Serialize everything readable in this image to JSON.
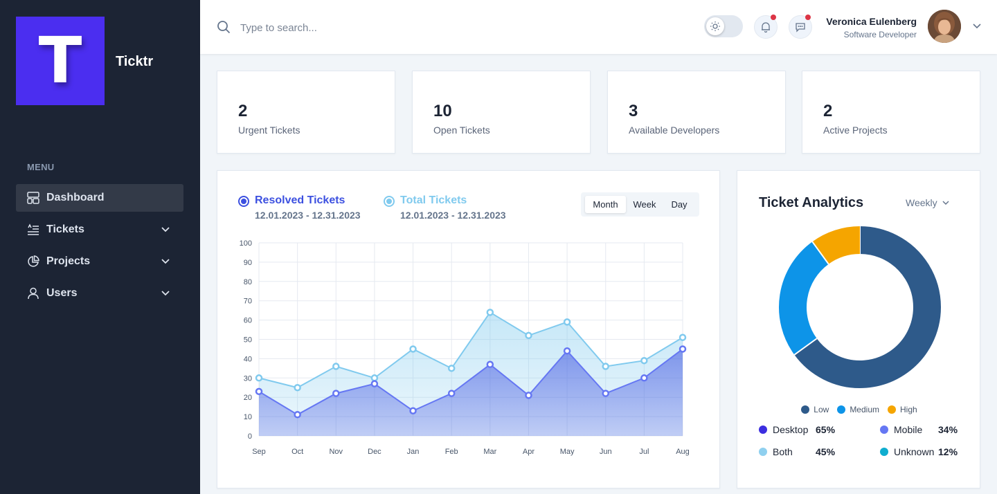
{
  "app": {
    "logo_letter": "T",
    "brand": "Ticktr"
  },
  "sidebar": {
    "menu_title": "MENU",
    "items": [
      {
        "label": "Dashboard",
        "icon": "dashboard-icon",
        "active": true
      },
      {
        "label": "Tickets",
        "icon": "tickets-icon",
        "expandable": true
      },
      {
        "label": "Projects",
        "icon": "projects-icon",
        "expandable": true
      },
      {
        "label": "Users",
        "icon": "users-icon",
        "expandable": true
      }
    ]
  },
  "header": {
    "search_placeholder": "Type to search...",
    "notifications_unread": true,
    "messages_unread": true,
    "user": {
      "name": "Veronica Eulenberg",
      "role": "Software Developer"
    }
  },
  "stats": [
    {
      "value": "2",
      "label": "Urgent Tickets"
    },
    {
      "value": "10",
      "label": "Open Tickets"
    },
    {
      "value": "3",
      "label": "Available Developers"
    },
    {
      "value": "2",
      "label": "Active Projects"
    }
  ],
  "chart_panel": {
    "legend": [
      {
        "title": "Resolved Tickets",
        "dates": "12.01.2023 - 12.31.2023",
        "color": "#3c50e0"
      },
      {
        "title": "Total Tickets",
        "dates": "12.01.2023 - 12.31.2023",
        "color": "#80caee"
      }
    ],
    "periods": [
      "Month",
      "Week",
      "Day"
    ],
    "active_period": "Month"
  },
  "chart_data": {
    "type": "area",
    "categories": [
      "Sep",
      "Oct",
      "Nov",
      "Dec",
      "Jan",
      "Feb",
      "Mar",
      "Apr",
      "May",
      "Jun",
      "Jul",
      "Aug"
    ],
    "series": [
      {
        "name": "Total Tickets",
        "color": "#80caee",
        "values": [
          30,
          25,
          36,
          30,
          45,
          35,
          64,
          52,
          59,
          36,
          39,
          51
        ]
      },
      {
        "name": "Resolved Tickets",
        "color": "#3c50e0",
        "values": [
          23,
          11,
          22,
          27,
          13,
          22,
          37,
          21,
          44,
          22,
          30,
          45
        ]
      }
    ],
    "ylim": [
      0,
      100
    ],
    "yticks": [
      0,
      10,
      20,
      30,
      40,
      50,
      60,
      70,
      80,
      90,
      100
    ],
    "grid": true,
    "legend": "top-left"
  },
  "analytics": {
    "title": "Ticket Analytics",
    "period": "Weekly",
    "donut": {
      "type": "pie",
      "slices": [
        {
          "label": "Low",
          "value": 65,
          "color": "#2e5a8a"
        },
        {
          "label": "Medium",
          "value": 25,
          "color": "#0d94e8"
        },
        {
          "label": "High",
          "value": 10,
          "color": "#f5a500"
        }
      ]
    },
    "devices": [
      {
        "label": "Desktop",
        "pct": "65%",
        "color": "#3c2ee0"
      },
      {
        "label": "Mobile",
        "pct": "34%",
        "color": "#6577f3"
      },
      {
        "label": "Both",
        "pct": "45%",
        "color": "#8fd0ef"
      },
      {
        "label": "Unknown",
        "pct": "12%",
        "color": "#0fadcf"
      }
    ]
  }
}
